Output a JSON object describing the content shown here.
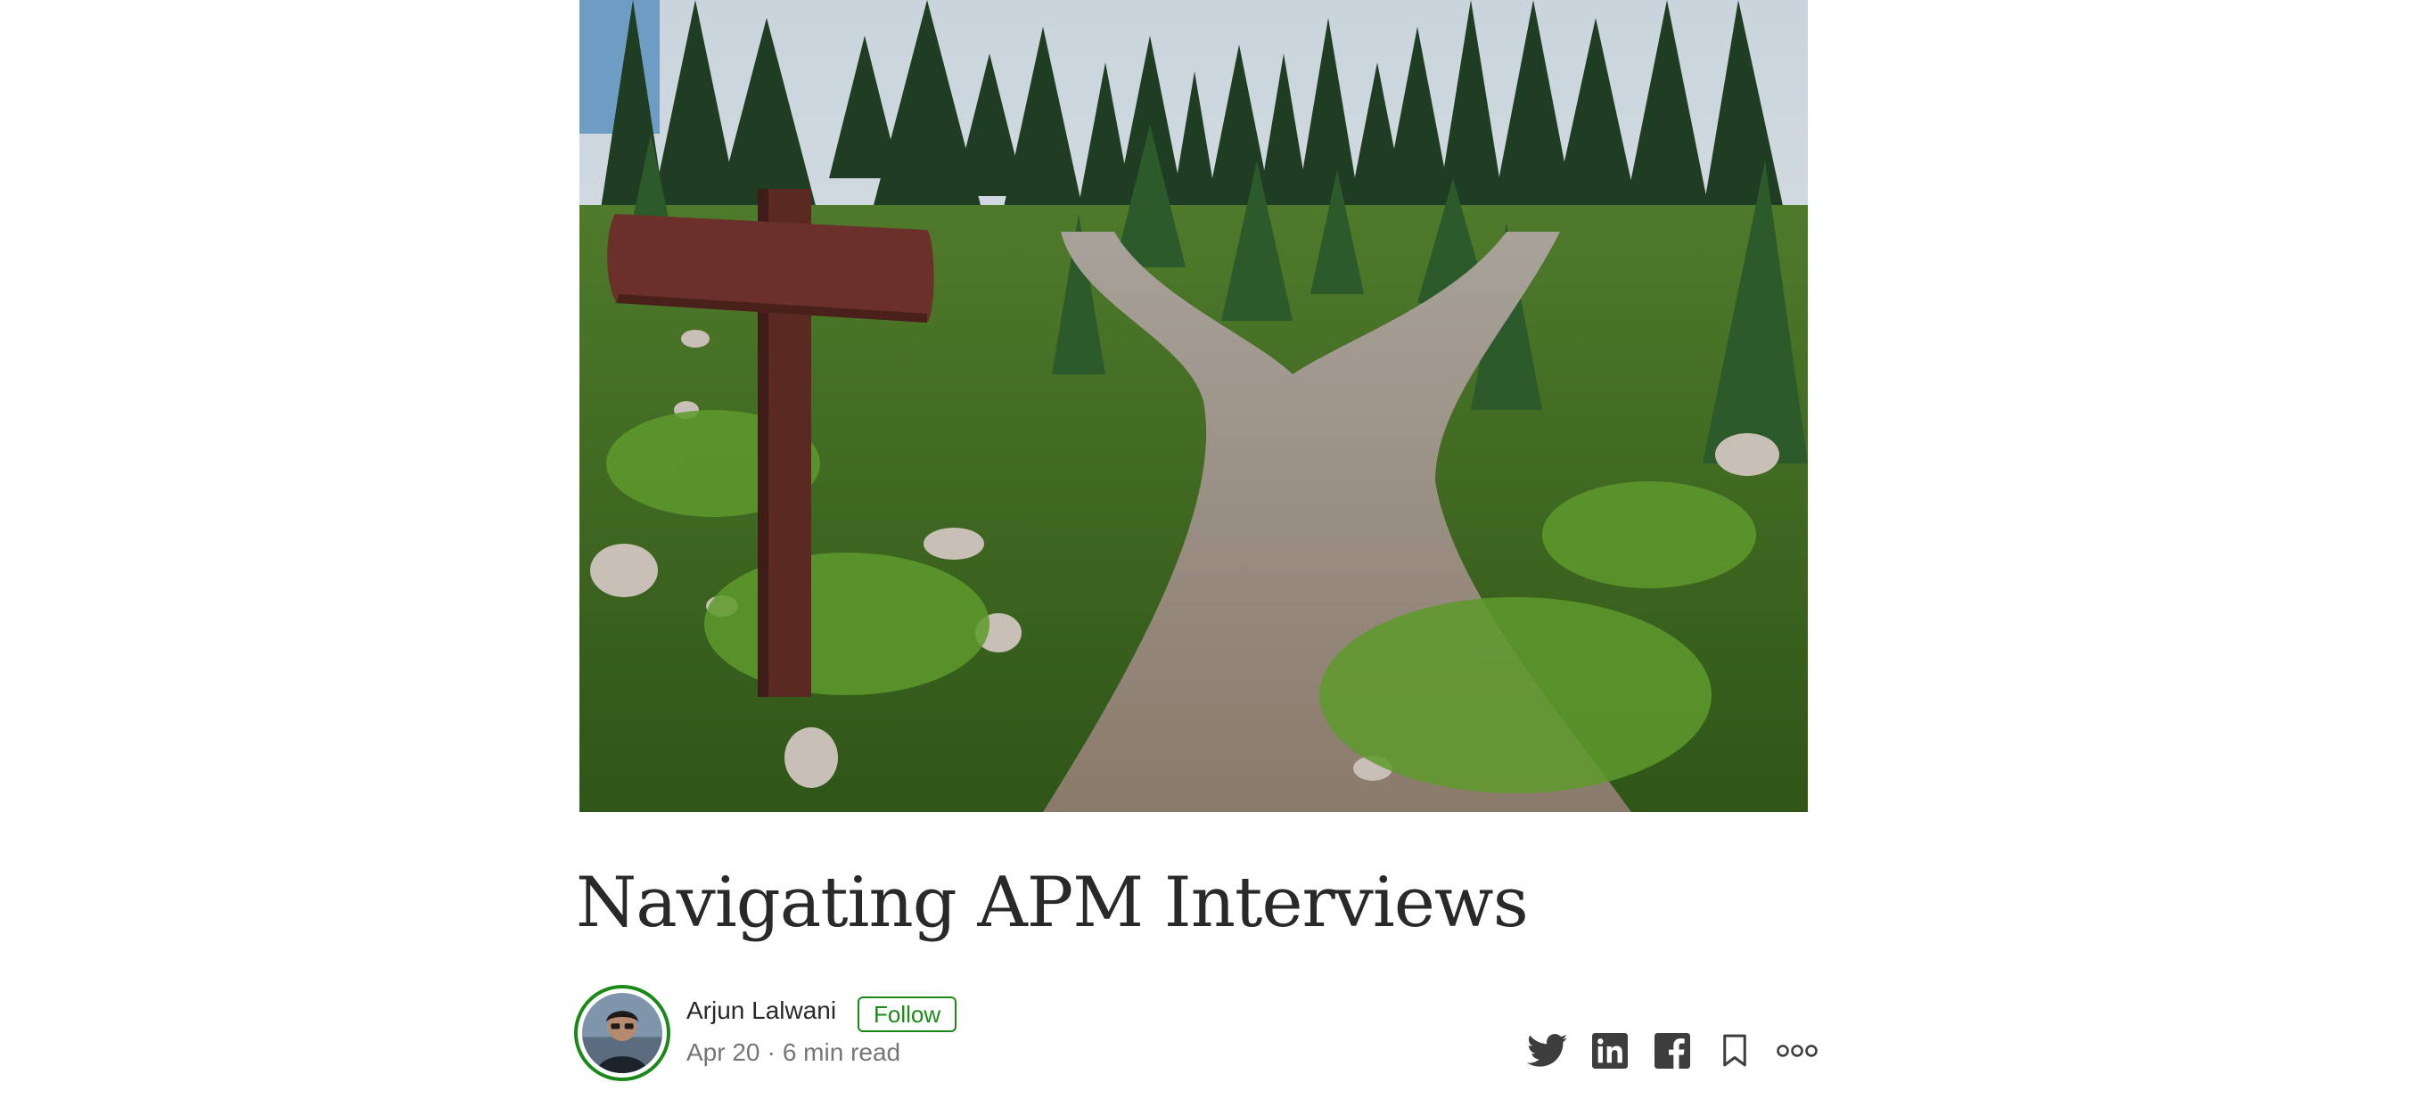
{
  "article": {
    "title": "Navigating APM Interviews",
    "hero_image": "forest trail forking with blank wooden signpost"
  },
  "author": {
    "name": "Arjun Lalwani",
    "follow_label": "Follow",
    "avatar_icon": "author-avatar"
  },
  "meta": {
    "date": "Apr 20",
    "separator": "·",
    "read_time": "6 min read"
  },
  "share_actions": [
    {
      "icon": "twitter-icon"
    },
    {
      "icon": "linkedin-icon"
    },
    {
      "icon": "facebook-icon"
    },
    {
      "icon": "bookmark-icon"
    },
    {
      "icon": "more-options-icon"
    }
  ],
  "colors": {
    "accent": "#1a8917",
    "text": "#292929",
    "muted": "#757575",
    "icon": "#3d3d3d"
  }
}
